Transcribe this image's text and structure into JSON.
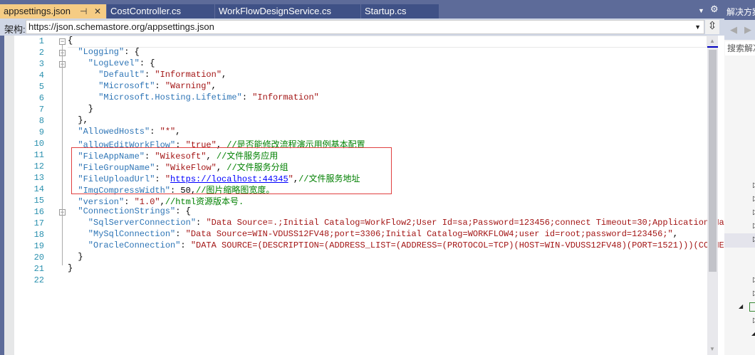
{
  "tabs": [
    {
      "label": "appsettings.json",
      "active": true
    },
    {
      "label": "CostController.cs"
    },
    {
      "label": "WorkFlowDesignService.cs"
    },
    {
      "label": "Startup.cs"
    }
  ],
  "schema": {
    "label": "架构:",
    "value": "https://json.schemastore.org/appsettings.json"
  },
  "right_panel": {
    "title": "解决方案资源管理器",
    "search_placeholder": "搜索解决方案"
  },
  "lines": [
    [
      [
        "p",
        "{"
      ]
    ],
    [
      [
        "k",
        "\"Logging\""
      ],
      [
        "p",
        ": {"
      ]
    ],
    [
      [
        "k",
        "\"LogLevel\""
      ],
      [
        "p",
        ": {"
      ]
    ],
    [
      [
        "k",
        "\"Default\""
      ],
      [
        "p",
        ": "
      ],
      [
        "s",
        "\"Information\""
      ],
      [
        "p",
        ","
      ]
    ],
    [
      [
        "k",
        "\"Microsoft\""
      ],
      [
        "p",
        ": "
      ],
      [
        "s",
        "\"Warning\""
      ],
      [
        "p",
        ","
      ]
    ],
    [
      [
        "k",
        "\"Microsoft.Hosting.Lifetime\""
      ],
      [
        "p",
        ": "
      ],
      [
        "s",
        "\"Information\""
      ]
    ],
    [
      [
        "p",
        "}"
      ]
    ],
    [
      [
        "p",
        "},"
      ]
    ],
    [
      [
        "k",
        "\"AllowedHosts\""
      ],
      [
        "p",
        ": "
      ],
      [
        "s",
        "\"*\""
      ],
      [
        "p",
        ","
      ]
    ],
    [
      [
        "k",
        "\"allowEditWorkFlow\""
      ],
      [
        "p",
        ": "
      ],
      [
        "s",
        "\"true\""
      ],
      [
        "p",
        ", "
      ],
      [
        "c",
        "//是否能修改流程演示用例基本配置"
      ]
    ],
    [
      [
        "k",
        "\"FileAppName\""
      ],
      [
        "p",
        ": "
      ],
      [
        "s",
        "\"Wikesoft\""
      ],
      [
        "p",
        ", "
      ],
      [
        "c",
        "//文件服务应用"
      ]
    ],
    [
      [
        "k",
        "\"FileGroupName\""
      ],
      [
        "p",
        ": "
      ],
      [
        "s",
        "\"WikeFlow\""
      ],
      [
        "p",
        ", "
      ],
      [
        "c",
        "//文件服务分组"
      ]
    ],
    [
      [
        "k",
        "\"FileUploadUrl\""
      ],
      [
        "p",
        ": "
      ],
      [
        "s",
        "\""
      ],
      [
        "u",
        "https://localhost:44345"
      ],
      [
        "s",
        "\""
      ],
      [
        "p",
        ","
      ],
      [
        "c",
        "//文件服务地址"
      ]
    ],
    [
      [
        "k",
        "\"ImgCompressWidth\""
      ],
      [
        "p",
        ": "
      ],
      [
        "n",
        "50"
      ],
      [
        "p",
        ","
      ],
      [
        "c",
        "//图片缩略图宽度。"
      ]
    ],
    [
      [
        "k",
        "\"version\""
      ],
      [
        "p",
        ": "
      ],
      [
        "s",
        "\"1.0\""
      ],
      [
        "p",
        ","
      ],
      [
        "c",
        "//html资源版本号."
      ]
    ],
    [
      [
        "k",
        "\"ConnectionStrings\""
      ],
      [
        "p",
        ": {"
      ]
    ],
    [
      [
        "k",
        "\"SqlServerConnection\""
      ],
      [
        "p",
        ": "
      ],
      [
        "s",
        "\"Data Source=.;Initial Catalog=WorkFlow2;User Id=sa;Password=123456;connect Timeout=30;Application Na"
      ]
    ],
    [
      [
        "k",
        "\"MySqlConnection\""
      ],
      [
        "p",
        ": "
      ],
      [
        "s",
        "\"Data Source=WIN-VDUSS12FV48;port=3306;Initial Catalog=WORKFLOW4;user id=root;password=123456;\""
      ],
      [
        "p",
        ","
      ]
    ],
    [
      [
        "k",
        "\"OracleConnection\""
      ],
      [
        "p",
        ": "
      ],
      [
        "s",
        "\"DATA SOURCE=(DESCRIPTION=(ADDRESS_LIST=(ADDRESS=(PROTOCOL=TCP)(HOST=WIN-VDUSS12FV48)(PORT=1521)))(CONNE"
      ]
    ],
    [
      [
        "p",
        "}"
      ]
    ],
    [
      [
        "p",
        "}"
      ]
    ],
    []
  ],
  "indent": [
    0,
    1,
    2,
    3,
    3,
    3,
    2,
    1,
    1,
    1,
    1,
    1,
    1,
    1,
    1,
    1,
    2,
    2,
    2,
    1,
    0,
    0
  ]
}
